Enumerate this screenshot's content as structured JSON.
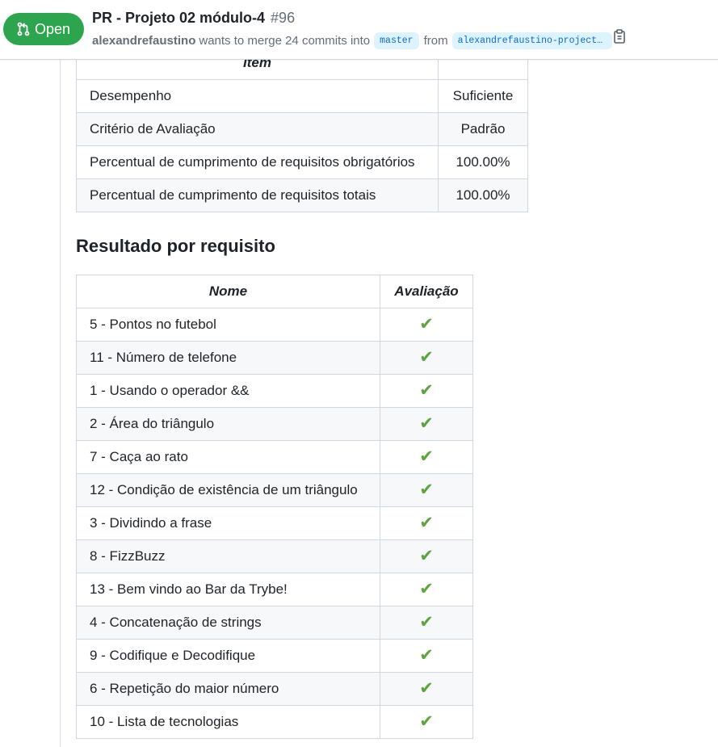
{
  "header": {
    "state": "Open",
    "title": "PR - Projeto 02 módulo-4",
    "number": "#96",
    "author": "alexandrefaustino",
    "merge_text": "wants to merge 24 commits into",
    "base_branch": "master",
    "from_text": "from",
    "head_branch": "alexandrefaustino-project-…"
  },
  "summary_table": {
    "headers": [
      "Item",
      ""
    ],
    "rows": [
      {
        "item": "Desempenho",
        "value": "Suficiente"
      },
      {
        "item": "Critério de Avaliação",
        "value": "Padrão"
      },
      {
        "item": "Percentual de cumprimento de requisitos obrigatórios",
        "value": "100.00%"
      },
      {
        "item": "Percentual de cumprimento de requisitos totais",
        "value": "100.00%"
      }
    ]
  },
  "section_title": "Resultado por requisito",
  "requirements_table": {
    "headers": [
      "Nome",
      "Avaliação"
    ],
    "rows": [
      {
        "name": "5 - Pontos no futebol",
        "mark": "✔"
      },
      {
        "name": "11 - Número de telefone",
        "mark": "✔"
      },
      {
        "name": "1 - Usando o operador &&",
        "mark": "✔"
      },
      {
        "name": "2 - Área do triângulo",
        "mark": "✔"
      },
      {
        "name": "7 - Caça ao rato",
        "mark": "✔"
      },
      {
        "name": "12 - Condição de existência de um triângulo",
        "mark": "✔"
      },
      {
        "name": "3 - Dividindo a frase",
        "mark": "✔"
      },
      {
        "name": "8 - FizzBuzz",
        "mark": "✔"
      },
      {
        "name": "13 - Bem vindo ao Bar da Trybe!",
        "mark": "✔"
      },
      {
        "name": "4 - Concatenação de strings",
        "mark": "✔"
      },
      {
        "name": "9 - Codifique e Decodifique",
        "mark": "✔"
      },
      {
        "name": "6 - Repetição do maior número",
        "mark": "✔"
      },
      {
        "name": "10 - Lista de tecnologias",
        "mark": "✔"
      }
    ]
  },
  "icons": {
    "state": "git-pull-request-icon",
    "copy": "clipboard-icon",
    "check": "check-mark-icon"
  },
  "colors": {
    "open_badge": "#2da44e",
    "branch_text": "#0969da",
    "branch_bg": "#ddf4ff",
    "check": "#5fa341"
  }
}
